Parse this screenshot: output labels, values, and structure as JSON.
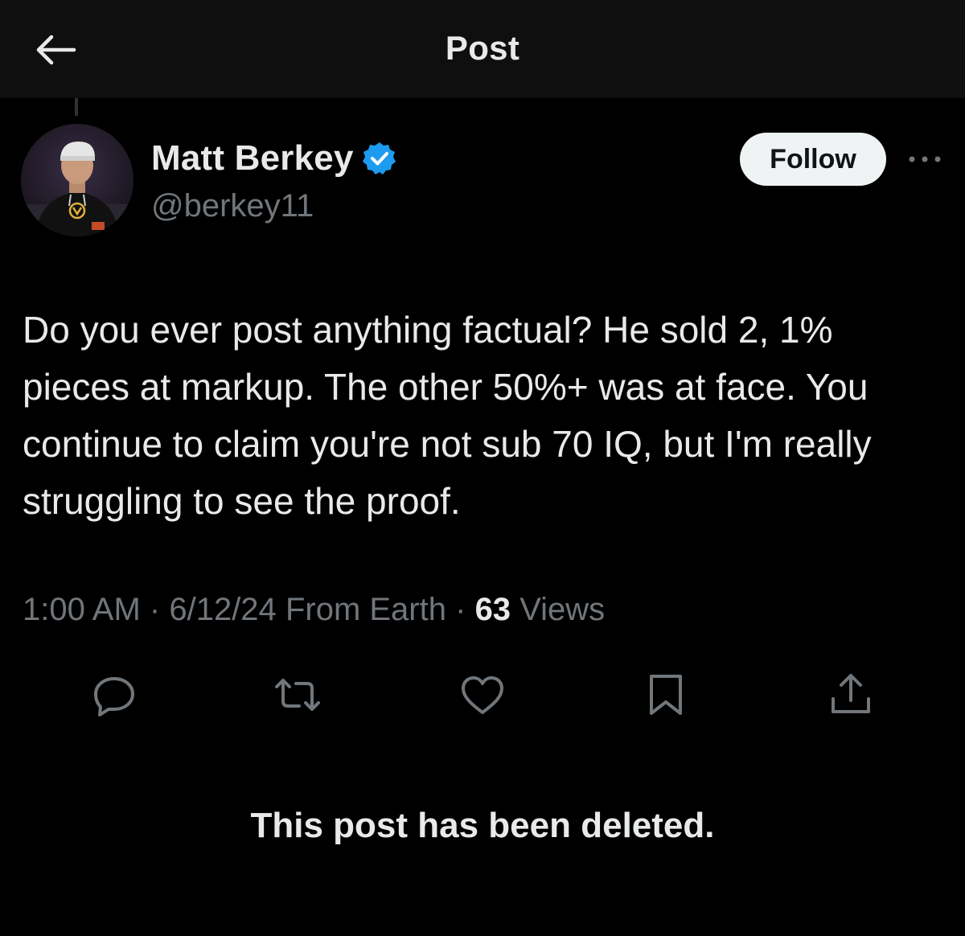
{
  "header": {
    "title": "Post",
    "back_icon": "arrow-left-icon"
  },
  "author": {
    "display_name": "Matt Berkey",
    "handle": "@berkey11",
    "verified": true,
    "verified_color": "#1d9bf0",
    "follow_label": "Follow",
    "more_icon": "more-horizontal-icon"
  },
  "post": {
    "text": "Do you ever post anything factual? He sold 2, 1% pieces at markup. The other 50%+ was at face. You continue to claim you're not sub 70 IQ, but I'm really struggling to see the proof.",
    "time": "1:00 AM",
    "separator": "·",
    "date": "6/12/24",
    "source": "From Earth",
    "views_count": "63",
    "views_label": "Views"
  },
  "actions": [
    {
      "name": "reply-icon"
    },
    {
      "name": "repost-icon"
    },
    {
      "name": "like-icon"
    },
    {
      "name": "bookmark-icon"
    },
    {
      "name": "share-icon"
    }
  ],
  "notice": {
    "deleted_text": "This post has been deleted."
  },
  "colors": {
    "background": "#000000",
    "header_background": "#0f0f0f",
    "primary_text": "#e7e9ea",
    "secondary_text": "#71767b",
    "follow_button_bg": "#eff3f4"
  }
}
